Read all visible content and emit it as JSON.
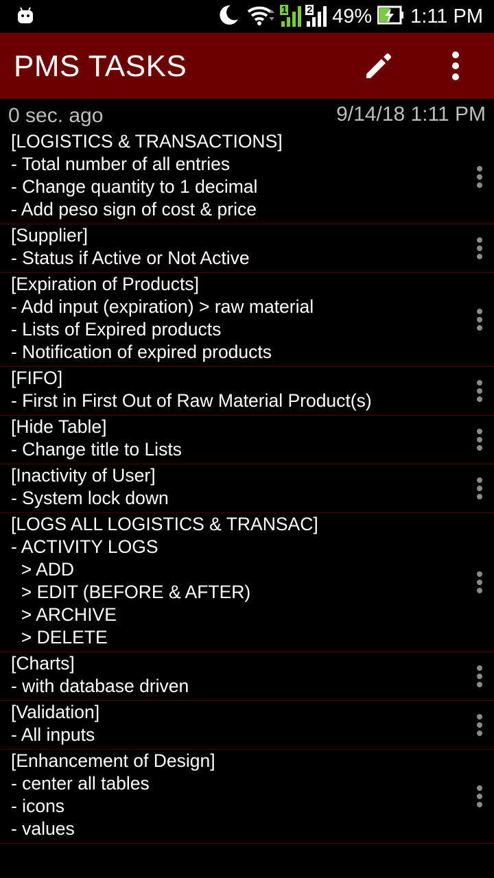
{
  "statusbar": {
    "android_icon": "android-robot-icon",
    "moon_icon": "do-not-disturb-moon-icon",
    "wifi_icon": "wifi-icon",
    "sim1_label": "1",
    "sim2_label": "2",
    "battery": "49%",
    "time": "1:11 PM"
  },
  "appbar": {
    "title": "PMS TASKS",
    "edit_icon": "pencil-icon",
    "more_icon": "more-vert-icon",
    "color": "#6b0000"
  },
  "sync": {
    "ago": "0 sec. ago",
    "datetime": "9/14/18 1:11 PM"
  },
  "tasks": [
    {
      "lines": [
        "[LOGISTICS & TRANSACTIONS]",
        "- Total number of all entries",
        "- Change quantity to 1 decimal",
        "- Add peso sign of cost & price"
      ]
    },
    {
      "lines": [
        "[Supplier]",
        "- Status if Active or Not Active"
      ]
    },
    {
      "lines": [
        "[Expiration of Products]",
        "- Add input (expiration) > raw material",
        "- Lists of Expired products",
        "- Notification of expired products"
      ]
    },
    {
      "lines": [
        "[FIFO]",
        "- First in First Out of Raw Material Product(s)"
      ]
    },
    {
      "lines": [
        "[Hide Table]",
        "- Change title to Lists"
      ]
    },
    {
      "lines": [
        "[Inactivity of User]",
        "- System lock down"
      ]
    },
    {
      "lines": [
        "[LOGS ALL LOGISTICS & TRANSAC]",
        "- ACTIVITY LOGS",
        "  > ADD",
        "  > EDIT (BEFORE & AFTER)",
        "  > ARCHIVE",
        "  > DELETE"
      ]
    },
    {
      "lines": [
        "[Charts]",
        "- with database driven"
      ]
    },
    {
      "lines": [
        "[Validation]",
        "- All inputs"
      ]
    },
    {
      "lines": [
        "[Enhancement of Design]",
        "- center all tables",
        "- icons",
        "- values"
      ]
    }
  ]
}
